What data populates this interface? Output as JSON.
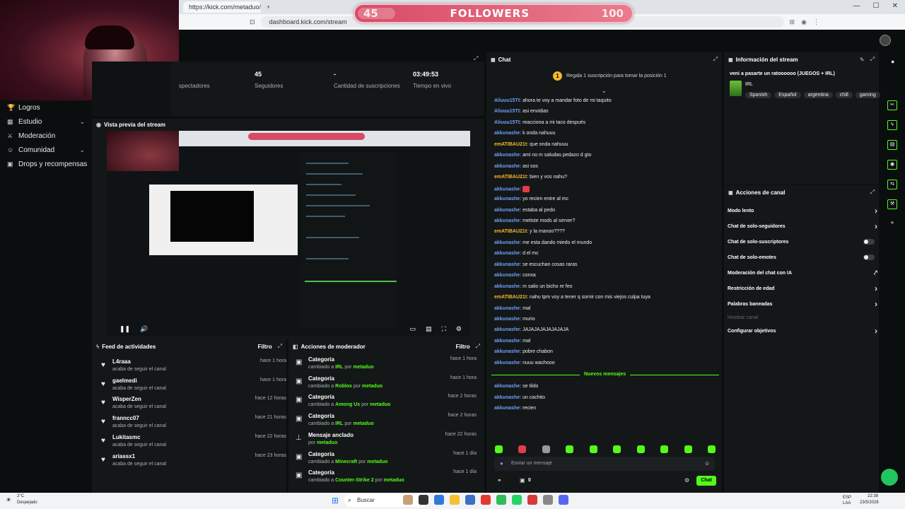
{
  "browser": {
    "tab_title": "https://kick.com/metaduo/...",
    "url": "dashboard.kick.com/stream",
    "win_min": "—",
    "win_max": "☐",
    "win_close": "✕"
  },
  "overlay": {
    "current": "45",
    "label": "FOLLOWERS",
    "goal": "100",
    "progress": 0.45
  },
  "sidebar": {
    "items": [
      {
        "label": "Logros",
        "icon": "trophy-icon",
        "chevron": false
      },
      {
        "label": "Estudio",
        "icon": "studio-icon",
        "chevron": true
      },
      {
        "label": "Moderación",
        "icon": "mod-icon",
        "chevron": false
      },
      {
        "label": "Comunidad",
        "icon": "community-icon",
        "chevron": true
      },
      {
        "label": "Drops y recompensas",
        "icon": "gift-icon",
        "chevron": false
      }
    ]
  },
  "stats": {
    "spectators_label": "spectadores",
    "followers_value": "45",
    "followers_label": "Seguidores",
    "subs_value": "-",
    "subs_label": "Cantidad de suscripciones",
    "time_value": "03:49:53",
    "time_label": "Tiempo en vivo"
  },
  "preview": {
    "title": "Vista previa del stream"
  },
  "feed": {
    "title": "Feed de actividades",
    "filter": "Filtro",
    "items": [
      {
        "name": "L4raaa",
        "sub": "acaba de seguir el canal",
        "time": "hace 1 hora"
      },
      {
        "name": "gaelmedi",
        "sub": "acaba de seguir el canal",
        "time": "hace 1 hora"
      },
      {
        "name": "WisperZen",
        "sub": "acaba de seguir el canal",
        "time": "hace 12 horas"
      },
      {
        "name": "franncc07",
        "sub": "acaba de seguir el canal",
        "time": "hace 21 horas"
      },
      {
        "name": "Lukitasmc",
        "sub": "acaba de seguir el canal",
        "time": "hace 22 horas"
      },
      {
        "name": "ariassx1",
        "sub": "acaba de seguir el canal",
        "time": "hace 23 horas"
      }
    ]
  },
  "mod": {
    "title": "Acciones de moderador",
    "filter": "Filtro",
    "items": [
      {
        "name": "Categoría",
        "pre": "cambiado a ",
        "val": "IRL",
        "mid": " por ",
        "by": "metaduo",
        "time": "hace 1 hora",
        "icon": "category-icon"
      },
      {
        "name": "Categoría",
        "pre": "cambiado a ",
        "val": "Roblox",
        "mid": " por ",
        "by": "metaduo",
        "time": "hace 1 hora",
        "icon": "category-icon"
      },
      {
        "name": "Categoría",
        "pre": "cambiado a ",
        "val": "Among Us",
        "mid": " por ",
        "by": "metaduo",
        "time": "hace 2 horas",
        "icon": "category-icon"
      },
      {
        "name": "Categoría",
        "pre": "cambiado a ",
        "val": "IRL",
        "mid": " por ",
        "by": "metaduo",
        "time": "hace 2 horas",
        "icon": "category-icon"
      },
      {
        "name": "Mensaje anclado",
        "pre": "",
        "val": "",
        "mid": "por ",
        "by": "metaduo",
        "time": "hace 22 horas",
        "icon": "pin-icon"
      },
      {
        "name": "Categoría",
        "pre": "cambiado a ",
        "val": "Minecraft",
        "mid": " por ",
        "by": "metaduo",
        "time": "hace 1 día",
        "icon": "category-icon"
      },
      {
        "name": "Categoría",
        "pre": "cambiado a ",
        "val": "Counter-Strike 2",
        "mid": " por ",
        "by": "metaduo",
        "time": "hace 1 día",
        "icon": "category-icon"
      }
    ]
  },
  "chat": {
    "title": "Chat",
    "pinned_coin": "1",
    "pinned": "Regala 1 suscripción para tomar la posición 1",
    "messages": [
      {
        "user": "Aliuuu15Tt",
        "text": "ahora te voy a mandar foto de mi taquito",
        "color": "#6f9ff8"
      },
      {
        "user": "Aliuuu15Tt",
        "text": "asi envidias",
        "color": "#6f9ff8"
      },
      {
        "user": "Aliuuu15Tt",
        "text": "reacciona a mi taco después",
        "color": "#6f9ff8"
      },
      {
        "user": "akkunashe",
        "text": "k onda nahuuu",
        "color": "#6f9ff8"
      },
      {
        "user": "emATIBAU21t",
        "text": "que onda nahuuu",
        "color": "#f5b82e"
      },
      {
        "user": "akkunashe",
        "text": "ami no m saludas pedazo d gto",
        "color": "#6f9ff8"
      },
      {
        "user": "akkunashe",
        "text": "asi sos",
        "color": "#6f9ff8"
      },
      {
        "user": "emATIBAU21t",
        "text": "bien y vos nahu?",
        "color": "#f5b82e"
      },
      {
        "user": "akkunashe",
        "text": "",
        "color": "#6f9ff8"
      },
      {
        "user": "akkunashe",
        "text": "yo recien entre al mc",
        "color": "#6f9ff8"
      },
      {
        "user": "akkunashe",
        "text": "estaba al pedo",
        "color": "#6f9ff8"
      },
      {
        "user": "akkunashe",
        "text": "metiste mods al server?",
        "color": "#6f9ff8"
      },
      {
        "user": "emATIBAU21t",
        "text": "y la manoo????",
        "color": "#f5b82e"
      },
      {
        "user": "akkunashe",
        "text": "me esta dando miedo el mundo",
        "color": "#6f9ff8"
      },
      {
        "user": "akkunashe",
        "text": "d el mc",
        "color": "#6f9ff8"
      },
      {
        "user": "akkunashe",
        "text": "se escuchan cosas raras",
        "color": "#6f9ff8"
      },
      {
        "user": "akkunashe",
        "text": "conxa",
        "color": "#6f9ff8"
      },
      {
        "user": "akkunashe",
        "text": "m salio un bicho re feo",
        "color": "#6f9ff8"
      },
      {
        "user": "emATIBAU21t",
        "text": "nahu tpm voy a tener q sornir con mis viejos culpa tuya",
        "color": "#f5b82e"
      },
      {
        "user": "akkunashe",
        "text": "mal",
        "color": "#6f9ff8"
      },
      {
        "user": "akkunashe",
        "text": "murio",
        "color": "#6f9ff8"
      },
      {
        "user": "akkunashe",
        "text": "JAJAJAJAJAJAJAJA",
        "color": "#6f9ff8"
      },
      {
        "user": "akkunashe",
        "text": "mal",
        "color": "#6f9ff8"
      },
      {
        "user": "akkunashe",
        "text": "pobre chabon",
        "color": "#6f9ff8"
      },
      {
        "user": "akkunashe",
        "text": "nuuu wachooo",
        "color": "#6f9ff8"
      }
    ],
    "new_label": "Nuevos mensajes",
    "new_messages": [
      {
        "user": "akkunashe",
        "text": "se tildo",
        "color": "#6f9ff8"
      },
      {
        "user": "akkunashe",
        "text": "un cachito",
        "color": "#6f9ff8"
      },
      {
        "user": "akkunashe",
        "text": "recien",
        "color": "#6f9ff8"
      }
    ],
    "placeholder": "Enviar un mensaje",
    "count": "0",
    "send": "Chat"
  },
  "info": {
    "title": "Información del stream",
    "stream_title": "veni a pasarte un ratoooooo (JUEGOS + IRL)",
    "category": "IRL",
    "tags": [
      "Spanish",
      "Español",
      "argentina",
      "chill",
      "gaming"
    ]
  },
  "actions": {
    "title": "Acciones de canal",
    "items": [
      {
        "label": "Modo lento",
        "type": "arrow"
      },
      {
        "label": "Chat de solo-seguidores",
        "type": "arrow"
      },
      {
        "label": "Chat de solo-suscriptores",
        "type": "toggle"
      },
      {
        "label": "Chat de solo-emotes",
        "type": "toggle"
      },
      {
        "label": "Moderación del chat con IA",
        "type": "ext"
      },
      {
        "label": "Restricción de edad",
        "type": "arrow"
      },
      {
        "label": "Palabras baneadas",
        "type": "arrow"
      },
      {
        "label": "Hostear canal",
        "type": "disabled"
      },
      {
        "label": "Configurar objetivos",
        "type": "arrow"
      }
    ]
  },
  "taskbar": {
    "weather_temp": "2°C",
    "weather_desc": "Despejado",
    "search": "Buscar",
    "lang": "ESP\nLAA",
    "time": "22:38",
    "date": "23/5/2026"
  },
  "colors": {
    "accent": "#53fc18",
    "bg": "#0b0e0f",
    "panel": "#141718"
  }
}
